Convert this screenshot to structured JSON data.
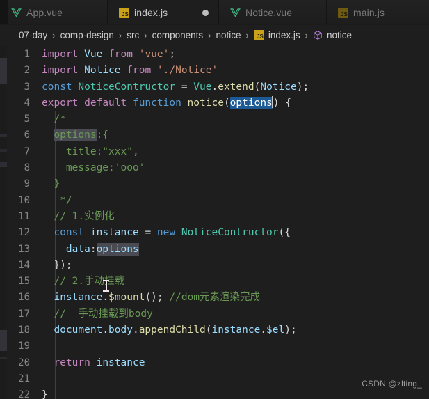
{
  "window": {
    "app": "Visual Studio Code",
    "theme_bg": "#1e1e1e",
    "accent": "#1c5a96"
  },
  "tabs": [
    {
      "label": "App.vue",
      "icon": "vue-icon",
      "active": false,
      "modified": false
    },
    {
      "label": "index.js",
      "icon": "js-icon",
      "active": true,
      "modified": true
    },
    {
      "label": "Notice.vue",
      "icon": "vue-icon",
      "active": false,
      "modified": false
    },
    {
      "label": "main.js",
      "icon": "js-icon",
      "active": false,
      "modified": false
    }
  ],
  "breadcrumb": {
    "separator": "›",
    "items": [
      {
        "label": "07-day",
        "icon": null
      },
      {
        "label": "comp-design",
        "icon": null
      },
      {
        "label": "src",
        "icon": null
      },
      {
        "label": "components",
        "icon": null
      },
      {
        "label": "notice",
        "icon": null
      },
      {
        "label": "index.js",
        "icon": "js-icon"
      },
      {
        "label": "notice",
        "icon": "cube-icon"
      }
    ]
  },
  "editor": {
    "language": "javascript",
    "file": "index.js",
    "selection": "options",
    "line_count": 22,
    "line_numbers": [
      "1",
      "2",
      "3",
      "4",
      "5",
      "6",
      "7",
      "8",
      "9",
      "10",
      "11",
      "12",
      "13",
      "14",
      "15",
      "16",
      "17",
      "18",
      "19",
      "20",
      "21",
      "22"
    ],
    "lines": [
      {
        "n": "1",
        "text": "import Vue from 'vue';"
      },
      {
        "n": "2",
        "text": "import Notice from './Notice'"
      },
      {
        "n": "3",
        "text": "const NoticeContructor = Vue.extend(Notice);"
      },
      {
        "n": "4",
        "text": "export default function notice(options) {"
      },
      {
        "n": "5",
        "text": "  /*"
      },
      {
        "n": "6",
        "text": "  options:{"
      },
      {
        "n": "7",
        "text": "    title:\"xxx\","
      },
      {
        "n": "8",
        "text": "    message:'ooo'"
      },
      {
        "n": "9",
        "text": "  }"
      },
      {
        "n": "10",
        "text": "  */"
      },
      {
        "n": "11",
        "text": "  // 1.实例化"
      },
      {
        "n": "12",
        "text": "  const instance = new NoticeContructor({"
      },
      {
        "n": "13",
        "text": "    data:options"
      },
      {
        "n": "14",
        "text": "  });"
      },
      {
        "n": "15",
        "text": "  // 2.手动挂载"
      },
      {
        "n": "16",
        "text": "  instance.$mount(); //dom元素渲染完成"
      },
      {
        "n": "17",
        "text": "  //  手动挂载到body"
      },
      {
        "n": "18",
        "text": "  document.body.appendChild(instance.$el);"
      },
      {
        "n": "19",
        "text": ""
      },
      {
        "n": "20",
        "text": "  return instance"
      },
      {
        "n": "21",
        "text": ""
      },
      {
        "n": "22",
        "text": "}"
      }
    ],
    "tokens": {
      "l1": {
        "kw": "import",
        "name": "Vue",
        "from": "from",
        "str": "'vue'",
        "semi": ";"
      },
      "l2": {
        "kw": "import",
        "name": "Notice",
        "from": "from",
        "str": "'./Notice'"
      },
      "l3": {
        "kw": "const",
        "name": "NoticeContructor",
        "eq": "=",
        "obj": "Vue",
        "dot": ".",
        "method": "extend",
        "open": "(",
        "arg": "Notice",
        "close": ")",
        "semi": ";"
      },
      "l4": {
        "kw": "export",
        "kw2": "default",
        "kw3": "function",
        "name": "notice",
        "open": "(",
        "param": "options",
        "close": ")",
        "brace": "{"
      },
      "l5": {
        "cm": "/*"
      },
      "l6": {
        "cm_hl": "options",
        "cm": ":{"
      },
      "l7": {
        "cm": "title:\"xxx\","
      },
      "l8": {
        "cm": "message:'ooo'"
      },
      "l9": {
        "cm": "}"
      },
      "l10": {
        "cm": "*/"
      },
      "l11": {
        "cm": "// 1.实例化"
      },
      "l12": {
        "kw": "const",
        "name": "instance",
        "eq": "=",
        "kw2": "new",
        "cls": "NoticeContructor",
        "tail": "({"
      },
      "l13": {
        "key": "data",
        "colon": ":",
        "val": "options"
      },
      "l14": {
        "text": "});"
      },
      "l15": {
        "cm": "// 2.手动挂载"
      },
      "l16": {
        "obj": "instance",
        "dot": ".",
        "method": "$mount",
        "call": "();",
        "cm": "//dom元素渲染完成"
      },
      "l17": {
        "cm": "//  手动挂载到body"
      },
      "l18": {
        "obj": "document",
        "d1": ".",
        "prop": "body",
        "d2": ".",
        "method": "appendChild",
        "open": "(",
        "arg": "instance",
        "d3": ".",
        "arg2": "$el",
        "close": ");"
      },
      "l20": {
        "kw": "return",
        "name": "instance"
      },
      "l22": {
        "brace": "}"
      }
    }
  },
  "watermark": {
    "text": "CSDN @zlting_"
  }
}
